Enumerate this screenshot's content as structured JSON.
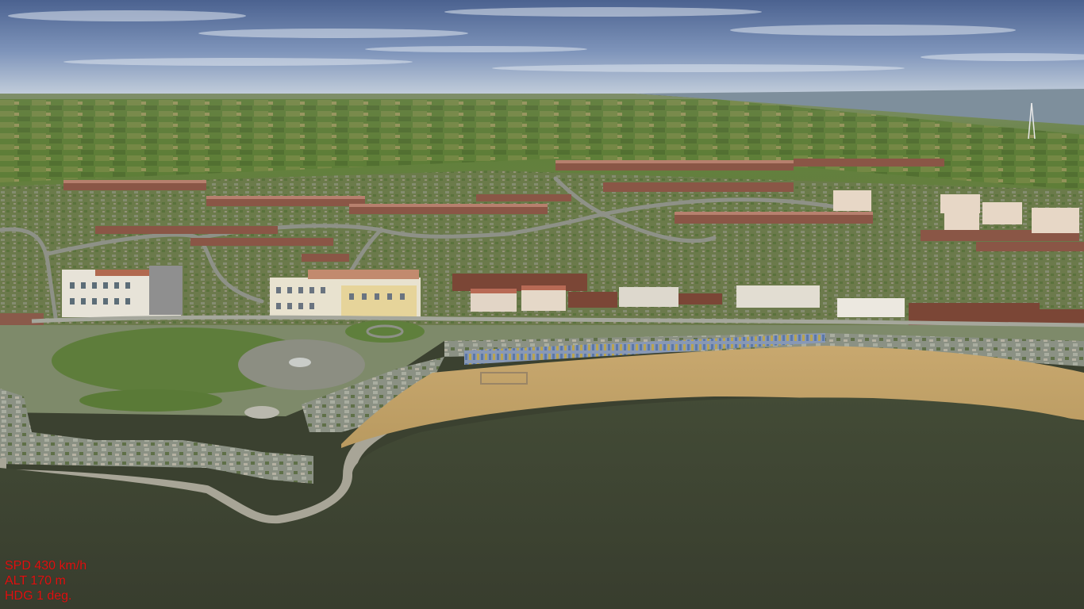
{
  "hud": {
    "speed": "SPD 430 km/h",
    "altitude": "ALT 170 m",
    "heading": "HDG 1 deg."
  },
  "colors": {
    "hud_text": "#e01010",
    "sea": "#3b4130",
    "beach": "#c9aa72",
    "grass": "#5f7a3a",
    "sky_top": "#4e6694",
    "sky_horizon": "#b9c6d6",
    "cliff": "#8a8f80",
    "brick": "#7a4a3a"
  }
}
